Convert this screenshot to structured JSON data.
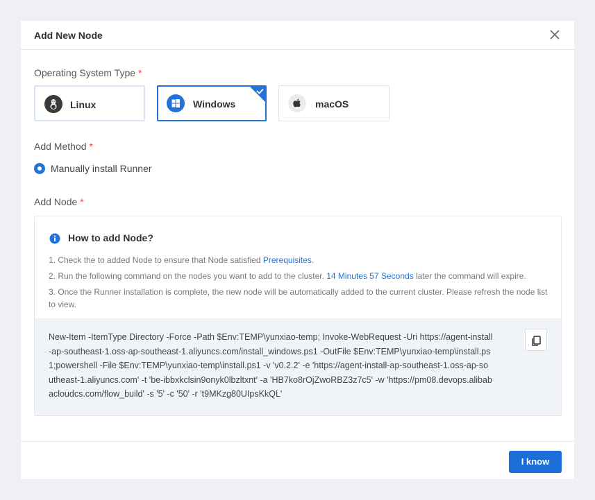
{
  "dialog": {
    "title": "Add New Node",
    "close_icon": "close-icon"
  },
  "os_type": {
    "label": "Operating System Type",
    "required_mark": "*",
    "options": [
      {
        "label": "Linux",
        "icon": "linux-icon",
        "selected": false
      },
      {
        "label": "Windows",
        "icon": "windows-icon",
        "selected": true
      },
      {
        "label": "macOS",
        "icon": "apple-icon",
        "selected": false
      }
    ]
  },
  "add_method": {
    "label": "Add Method",
    "required_mark": "*",
    "option": "Manually install Runner",
    "selected": true
  },
  "add_node": {
    "label": "Add Node",
    "required_mark": "*",
    "how_title": "How to add Node?",
    "step1_prefix": "1. Check the to added Node to ensure that Node satisfied ",
    "step1_link": "Prerequisites",
    "step1_suffix": ".",
    "step2_prefix": "2. Run the following command on the nodes you want to add to the cluster. ",
    "step2_time": "14 Minutes 57 Seconds",
    "step2_suffix": " later the command will expire.",
    "step3": "3. Once the Runner installation is complete, the new node will be automatically added to the current cluster. Please refresh the node list to view.",
    "command": "New-Item -ItemType Directory -Force -Path $Env:TEMP\\yunxiao-temp; Invoke-WebRequest -Uri https://agent-install-ap-southeast-1.oss-ap-southeast-1.aliyuncs.com/install_windows.ps1 -OutFile $Env:TEMP\\yunxiao-temp\\install.ps1;powershell -File $Env:TEMP\\yunxiao-temp\\install.ps1 -v 'v0.2.2' -e 'https://agent-install-ap-southeast-1.oss-ap-southeast-1.aliyuncs.com' -t 'be-ibbxkclsin9onyk0lbzltxnt' -a 'HB7ko8rOjZwoRBZ3z7c5' -w 'https://pm08.devops.alibabacloudcs.com/flow_build' -s '5' -c '50' -r 't9MKzg80UIpsKkQL'",
    "copy_icon": "copy-icon"
  },
  "footer": {
    "ok_label": "I know"
  },
  "colors": {
    "accent": "#2272d9",
    "required": "#e54545",
    "background": "#eef0f3"
  }
}
